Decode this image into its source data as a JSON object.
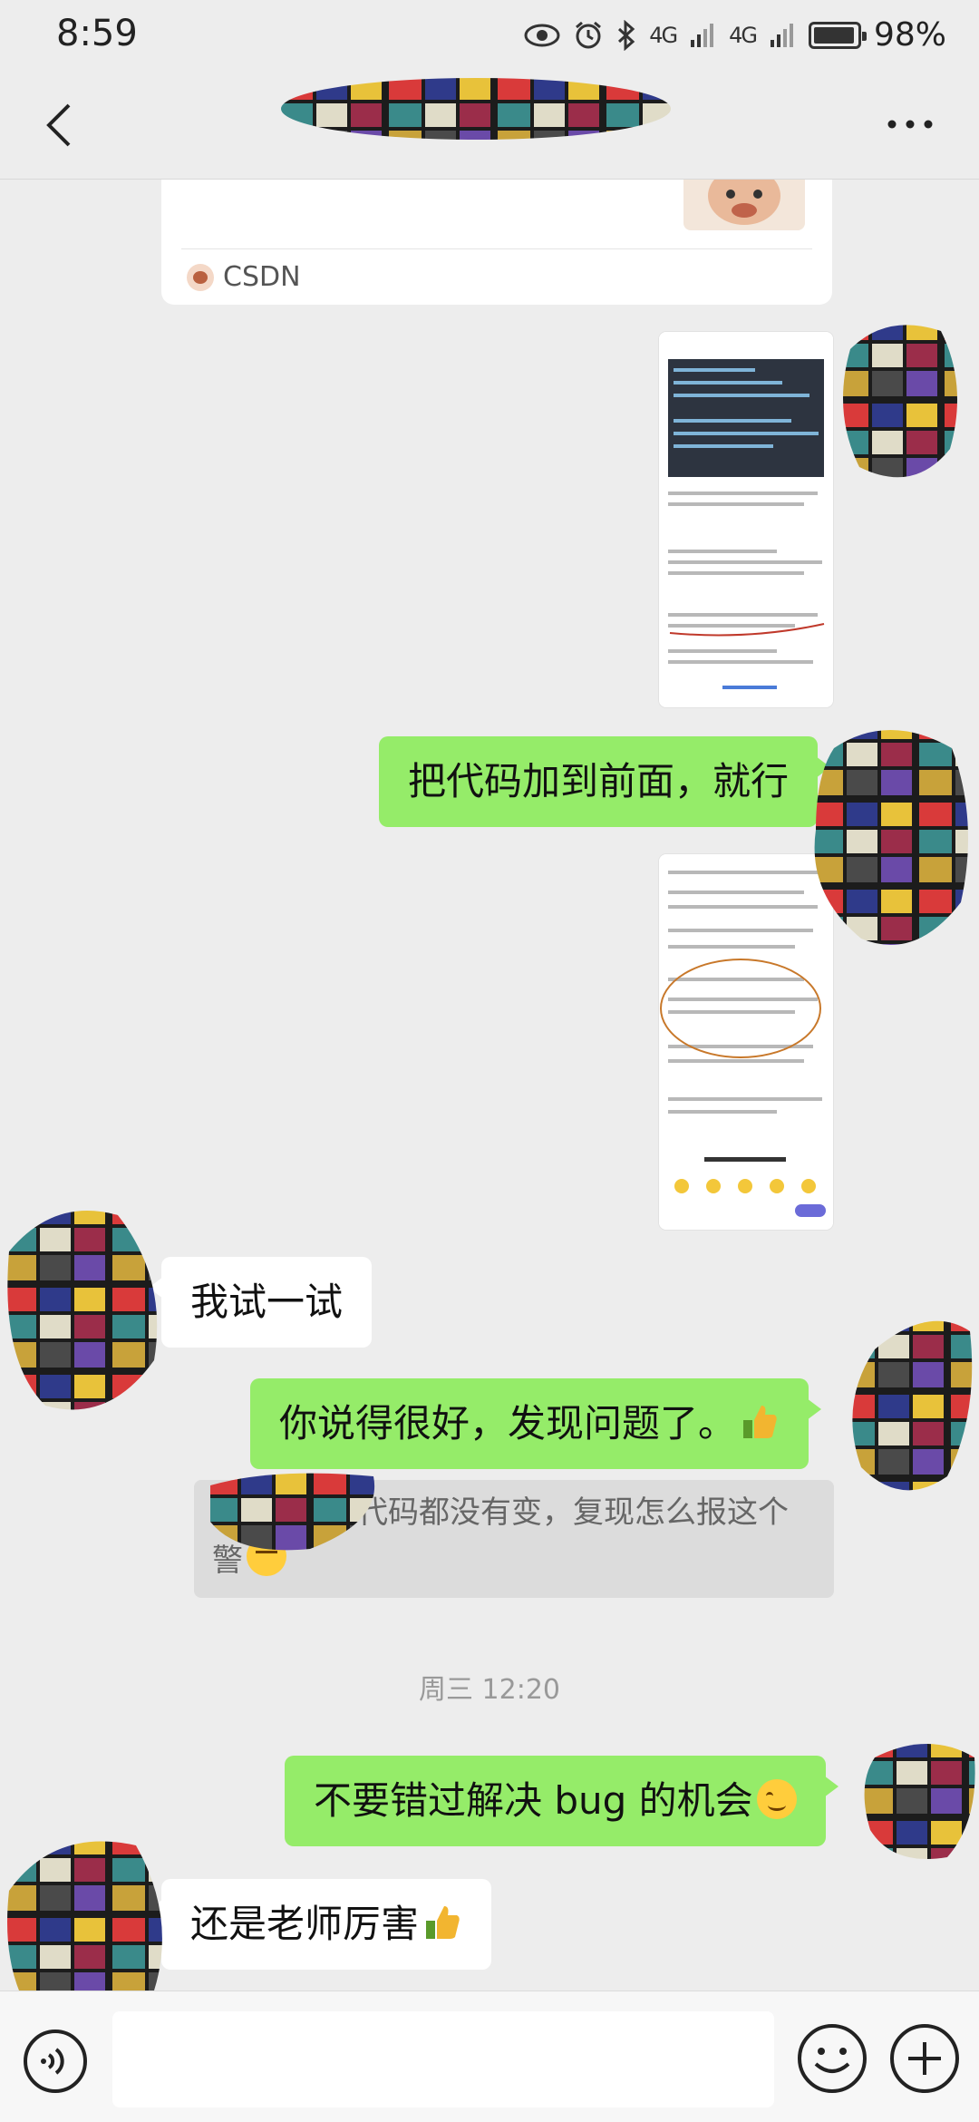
{
  "status_bar": {
    "time": "8:59",
    "net1": "4G",
    "net2": "4G",
    "battery": "98%",
    "icons": [
      "eye-icon",
      "alarm-icon",
      "bluetooth-icon",
      "signal-icon",
      "signal-icon",
      "battery-icon"
    ]
  },
  "nav": {
    "back_icon": "chevron-left-icon",
    "more_icon": "more-dots-icon"
  },
  "shared_card": {
    "source": "CSDN"
  },
  "messages": {
    "m1": "把代码加到前面，就行",
    "m2": "我试一试",
    "m3": "你说得很好，发现问题了。",
    "quote_line1": "代码都没有变，复现怎么报这个",
    "quote_line2": "警",
    "timestamp": "周三 12:20",
    "m4": "不要错过解决 bug 的机会",
    "m5": "还是老师厉害"
  },
  "input_bar": {
    "placeholder": "",
    "voice_icon": "voice-icon",
    "emoji_icon": "emoji-icon",
    "plus_icon": "plus-icon"
  },
  "colors": {
    "background": "#ededed",
    "my_bubble": "#95ec69",
    "other_bubble": "#ffffff",
    "quote_bg": "#dcdcdc",
    "timestamp": "#999999"
  }
}
